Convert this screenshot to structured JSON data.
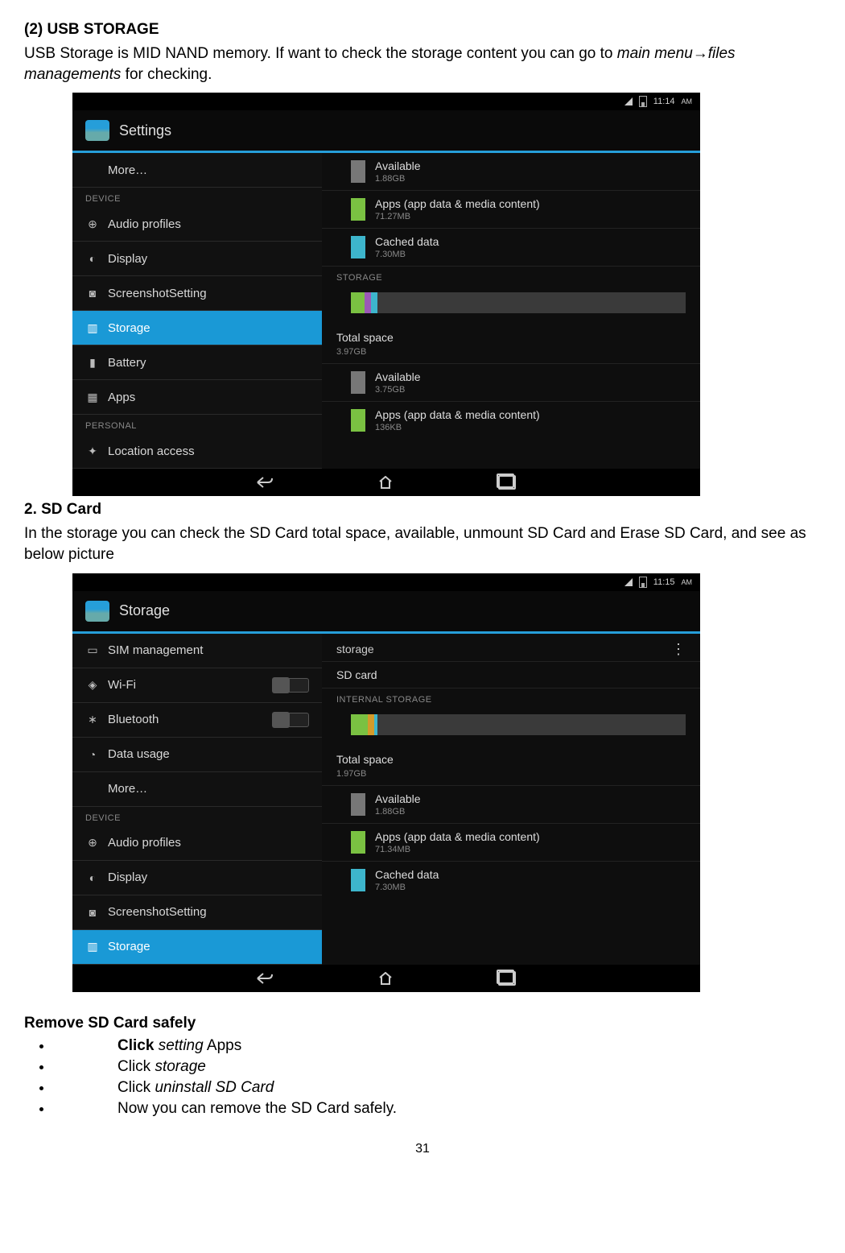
{
  "doc": {
    "h1": "(2) USB STORAGE",
    "p1a": "USB Storage is MID NAND memory. If want to check the storage content you can go to ",
    "p1b": "main menu",
    "p1arrow": "→",
    "p1c": "files managements",
    "p1d": " for checking.",
    "h2": "2. SD Card",
    "p2": "In the storage you can check the SD Card total space, available, unmount SD Card and Erase SD Card, and see as below picture",
    "h3": "Remove SD Card safely",
    "bullets": [
      {
        "bold": "Click ",
        "italic": "setting",
        "rest": " Apps"
      },
      {
        "bold": "",
        "plain": "Click ",
        "italic": "storage",
        "rest": ""
      },
      {
        "bold": "",
        "plain": "Click   ",
        "italic": "uninstall SD Card",
        "rest": ""
      },
      {
        "bold": "",
        "plain": "Now you can remove the SD Card safely.",
        "italic": "",
        "rest": ""
      }
    ],
    "pagenum": "31"
  },
  "shot1": {
    "time": "11:14",
    "ampm": "AM",
    "title": "Settings",
    "left": {
      "more": "More…",
      "cat_device": "DEVICE",
      "audio": "Audio profiles",
      "display": "Display",
      "screenshot": "ScreenshotSetting",
      "storage": "Storage",
      "battery": "Battery",
      "apps": "Apps",
      "cat_personal": "PERSONAL",
      "location": "Location access"
    },
    "right": {
      "avail_t": "Available",
      "avail_v": "1.88GB",
      "apps_t": "Apps (app data & media content)",
      "apps_v": "71.27MB",
      "cache_t": "Cached data",
      "cache_v": "7.30MB",
      "cat_storage": "STORAGE",
      "total_t": "Total space",
      "total_v": "3.97GB",
      "avail2_t": "Available",
      "avail2_v": "3.75GB",
      "apps2_t": "Apps (app data & media content)",
      "apps2_v": "136KB"
    }
  },
  "shot2": {
    "time": "11:15",
    "ampm": "AM",
    "title": "Storage",
    "left": {
      "sim": "SIM management",
      "wifi": "Wi-Fi",
      "bt": "Bluetooth",
      "data": "Data usage",
      "more": "More…",
      "cat_device": "DEVICE",
      "audio": "Audio profiles",
      "display": "Display",
      "screenshot": "ScreenshotSetting",
      "storage": "Storage"
    },
    "right": {
      "storage": "storage",
      "sdcard": "SD card",
      "cat_internal": "INTERNAL STORAGE",
      "total_t": "Total space",
      "total_v": "1.97GB",
      "avail_t": "Available",
      "avail_v": "1.88GB",
      "apps_t": "Apps (app data & media content)",
      "apps_v": "71.34MB",
      "cache_t": "Cached data",
      "cache_v": "7.30MB"
    }
  },
  "colors": {
    "avail": "#777777",
    "apps": "#7ac142",
    "cache": "#3db5cc",
    "purple": "#9b59b6",
    "orange": "#d39b2b"
  }
}
